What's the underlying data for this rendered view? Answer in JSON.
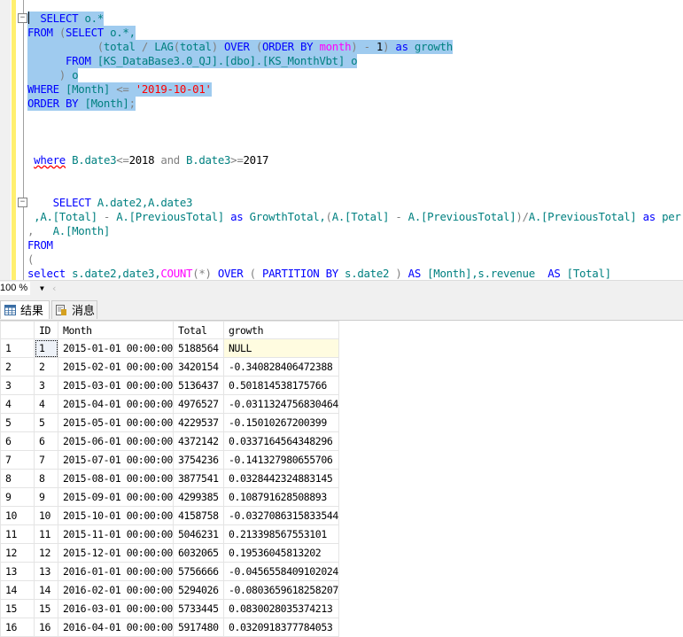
{
  "editor": {
    "lines": [
      {
        "sel": true,
        "tokens": [
          [
            "  SELECT ",
            "kw"
          ],
          [
            "o.*",
            "id"
          ]
        ]
      },
      {
        "sel": true,
        "tokens": [
          [
            "FROM ",
            "kw"
          ],
          [
            "(",
            "op"
          ],
          [
            "SELECT ",
            "kw"
          ],
          [
            "o.*,",
            "id"
          ]
        ]
      },
      {
        "sel": true,
        "tokens": [
          [
            "           (",
            "op"
          ],
          [
            "total ",
            "id"
          ],
          [
            "/ ",
            "op"
          ],
          [
            "LAG",
            "id"
          ],
          [
            "(",
            "op"
          ],
          [
            "total",
            "id"
          ],
          [
            ") ",
            "op"
          ],
          [
            "OVER ",
            "kw"
          ],
          [
            "(",
            "op"
          ],
          [
            "ORDER BY ",
            "kw"
          ],
          [
            "month",
            "fn"
          ],
          [
            ") - ",
            "op"
          ],
          [
            "1",
            "pl"
          ],
          [
            ") ",
            "op"
          ],
          [
            "as ",
            "kw"
          ],
          [
            "growth",
            "id"
          ]
        ]
      },
      {
        "sel": true,
        "tokens": [
          [
            "      FROM ",
            "kw"
          ],
          [
            "[KS_DataBase3.0_QJ].[dbo].[KS_MonthVbt] o",
            "id"
          ]
        ]
      },
      {
        "sel": true,
        "tokens": [
          [
            "     ) ",
            "op"
          ],
          [
            "o",
            "id"
          ]
        ]
      },
      {
        "sel": true,
        "tokens": [
          [
            "WHERE ",
            "kw"
          ],
          [
            "[Month] ",
            "id"
          ],
          [
            "<= ",
            "op"
          ],
          [
            "'2019-10-01'",
            "str"
          ]
        ]
      },
      {
        "sel": true,
        "tokens": [
          [
            "ORDER BY ",
            "kw"
          ],
          [
            "[Month]",
            "id"
          ],
          [
            ";",
            "op"
          ]
        ]
      },
      {
        "sel": false,
        "tokens": [
          [
            " ",
            "pl"
          ],
          [
            "where",
            "kw squig"
          ],
          [
            " B.date3",
            "id"
          ],
          [
            "<=",
            "op"
          ],
          [
            "2018 ",
            "pl"
          ],
          [
            "and ",
            "op"
          ],
          [
            "B.date3",
            "id"
          ],
          [
            ">=",
            "op"
          ],
          [
            "2017",
            "pl"
          ]
        ]
      },
      {
        "sel": false,
        "tokens": [
          [
            "    SELECT ",
            "kw"
          ],
          [
            "A.date2,A.date3",
            "id"
          ]
        ]
      },
      {
        "sel": false,
        "tokens": [
          [
            " ,A.[Total] ",
            "id"
          ],
          [
            "- ",
            "op"
          ],
          [
            "A.[PreviousTotal] ",
            "id"
          ],
          [
            "as ",
            "kw"
          ],
          [
            "GrowthTotal,",
            "id"
          ],
          [
            "(",
            "op"
          ],
          [
            "A.[Total] ",
            "id"
          ],
          [
            "- ",
            "op"
          ],
          [
            "A.[PreviousTotal]",
            "id"
          ],
          [
            ")/",
            "op"
          ],
          [
            "A.[PreviousTotal] ",
            "id"
          ],
          [
            "as ",
            "kw"
          ],
          [
            "per",
            "id"
          ]
        ]
      },
      {
        "sel": false,
        "tokens": [
          [
            ",   ",
            "op"
          ],
          [
            "A.[Month]",
            "id"
          ]
        ]
      },
      {
        "sel": false,
        "tokens": [
          [
            "FROM",
            "kw"
          ]
        ]
      },
      {
        "sel": false,
        "tokens": [
          [
            "(",
            "op"
          ]
        ]
      },
      {
        "sel": false,
        "tokens": [
          [
            "select ",
            "kw"
          ],
          [
            "s.date2,date3,",
            "id"
          ],
          [
            "COUNT",
            "fn"
          ],
          [
            "(*) ",
            "op"
          ],
          [
            "OVER ",
            "kw"
          ],
          [
            "( ",
            "op"
          ],
          [
            "PARTITION BY ",
            "kw"
          ],
          [
            "s.date2 ",
            "id"
          ],
          [
            ") ",
            "op"
          ],
          [
            "AS ",
            "kw"
          ],
          [
            "[Month],s.revenue  ",
            "id"
          ],
          [
            "AS ",
            "kw"
          ],
          [
            "[Total]",
            "id"
          ]
        ]
      }
    ]
  },
  "zoom": {
    "value": "100 %"
  },
  "tabs": [
    {
      "label": "结果"
    },
    {
      "label": "消息"
    }
  ],
  "grid": {
    "columns": [
      "",
      "ID",
      "Month",
      "Total",
      "growth"
    ],
    "rows": [
      [
        "1",
        "1",
        "2015-01-01 00:00:00",
        "5188564",
        "NULL"
      ],
      [
        "2",
        "2",
        "2015-02-01 00:00:00",
        "3420154",
        "-0.340828406472388"
      ],
      [
        "3",
        "3",
        "2015-03-01 00:00:00",
        "5136437",
        "0.501814538175766"
      ],
      [
        "4",
        "4",
        "2015-04-01 00:00:00",
        "4976527",
        "-0.0311324756830464"
      ],
      [
        "5",
        "5",
        "2015-05-01 00:00:00",
        "4229537",
        "-0.15010267200399"
      ],
      [
        "6",
        "6",
        "2015-06-01 00:00:00",
        "4372142",
        "0.0337164564348296"
      ],
      [
        "7",
        "7",
        "2015-07-01 00:00:00",
        "3754236",
        "-0.141327980655706"
      ],
      [
        "8",
        "8",
        "2015-08-01 00:00:00",
        "3877541",
        "0.0328442324883145"
      ],
      [
        "9",
        "9",
        "2015-09-01 00:00:00",
        "4299385",
        "0.108791628508893"
      ],
      [
        "10",
        "10",
        "2015-10-01 00:00:00",
        "4158758",
        "-0.0327086315833544"
      ],
      [
        "11",
        "11",
        "2015-11-01 00:00:00",
        "5046231",
        "0.213398567553101"
      ],
      [
        "12",
        "12",
        "2015-12-01 00:00:00",
        "6032065",
        "0.19536045813202"
      ],
      [
        "13",
        "13",
        "2016-01-01 00:00:00",
        "5756666",
        "-0.0456558409102024"
      ],
      [
        "14",
        "14",
        "2016-02-01 00:00:00",
        "5294026",
        "-0.0803659618258207"
      ],
      [
        "15",
        "15",
        "2016-03-01 00:00:00",
        "5733445",
        "0.0830028035374213"
      ],
      [
        "16",
        "16",
        "2016-04-01 00:00:00",
        "5917480",
        "0.0320918377784053"
      ]
    ]
  }
}
